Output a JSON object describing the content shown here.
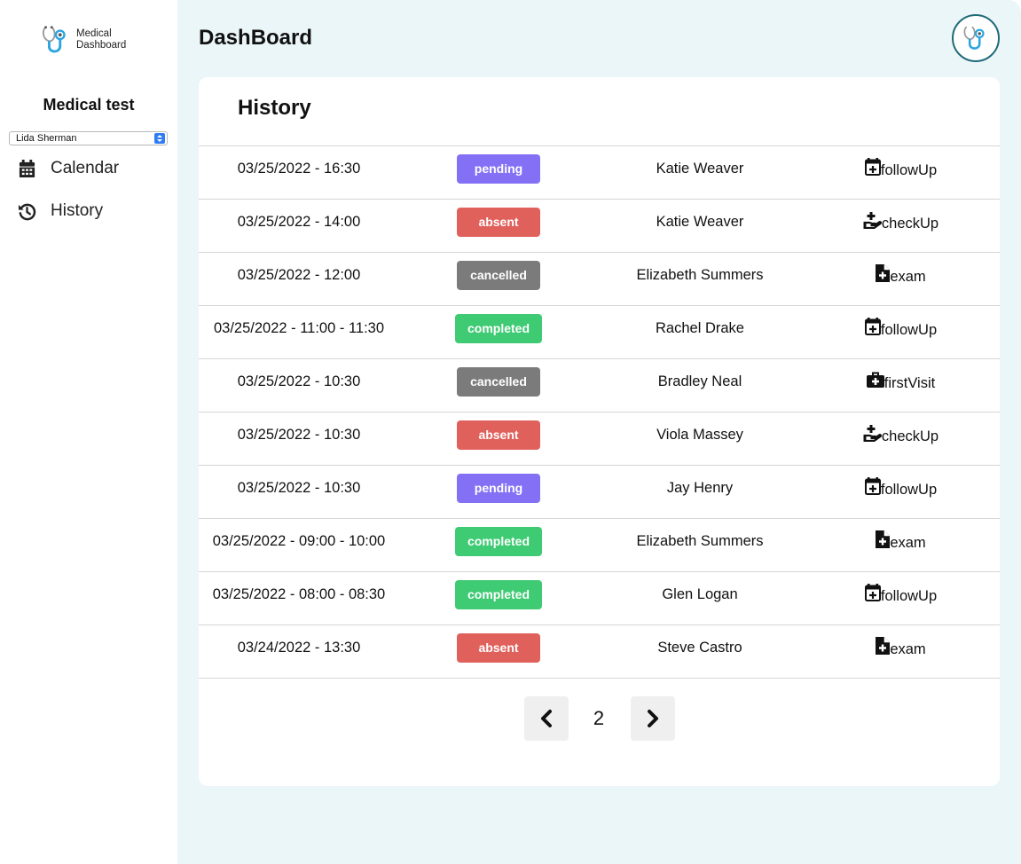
{
  "sidebar": {
    "logo_line1": "Medical",
    "logo_line2": "Dashboard",
    "app_title": "Medical test",
    "patient_select": "Lida Sherman",
    "nav": [
      {
        "label": "Calendar",
        "icon": "calendar-icon"
      },
      {
        "label": "History",
        "icon": "history-icon"
      }
    ]
  },
  "header": {
    "title": "DashBoard",
    "avatar_icon": "stethoscope-icon"
  },
  "history": {
    "title": "History",
    "rows": [
      {
        "datetime": "03/25/2022 - 16:30",
        "status": "pending",
        "patient": "Katie Weaver",
        "type": "followUp",
        "type_icon": "calendar-plus-icon"
      },
      {
        "datetime": "03/25/2022 - 14:00",
        "status": "absent",
        "patient": "Katie Weaver",
        "type": "checkUp",
        "type_icon": "hand-holding-medical-icon"
      },
      {
        "datetime": "03/25/2022 - 12:00",
        "status": "cancelled",
        "patient": "Elizabeth Summers",
        "type": "exam",
        "type_icon": "file-medical-icon"
      },
      {
        "datetime": "03/25/2022 - 11:00 - 11:30",
        "status": "completed",
        "patient": "Rachel Drake",
        "type": "followUp",
        "type_icon": "calendar-plus-icon"
      },
      {
        "datetime": "03/25/2022 - 10:30",
        "status": "cancelled",
        "patient": "Bradley Neal",
        "type": "firstVisit",
        "type_icon": "medkit-icon"
      },
      {
        "datetime": "03/25/2022 - 10:30",
        "status": "absent",
        "patient": "Viola Massey",
        "type": "checkUp",
        "type_icon": "hand-holding-medical-icon"
      },
      {
        "datetime": "03/25/2022 - 10:30",
        "status": "pending",
        "patient": "Jay Henry",
        "type": "followUp",
        "type_icon": "calendar-plus-icon"
      },
      {
        "datetime": "03/25/2022 - 09:00 - 10:00",
        "status": "completed",
        "patient": "Elizabeth Summers",
        "type": "exam",
        "type_icon": "file-medical-icon"
      },
      {
        "datetime": "03/25/2022 - 08:00 - 08:30",
        "status": "completed",
        "patient": "Glen Logan",
        "type": "followUp",
        "type_icon": "calendar-plus-icon"
      },
      {
        "datetime": "03/24/2022 - 13:30",
        "status": "absent",
        "patient": "Steve Castro",
        "type": "exam",
        "type_icon": "file-medical-icon"
      }
    ],
    "pagination": {
      "current_page": "2",
      "prev_icon": "chevron-left-icon",
      "next_icon": "chevron-right-icon"
    }
  },
  "colors": {
    "main_bg": "#ebf6f9",
    "pending": "#8470f5",
    "absent": "#e0605b",
    "cancelled": "#7b7b7b",
    "completed": "#3fcb74",
    "brand": "#1f6b78"
  }
}
